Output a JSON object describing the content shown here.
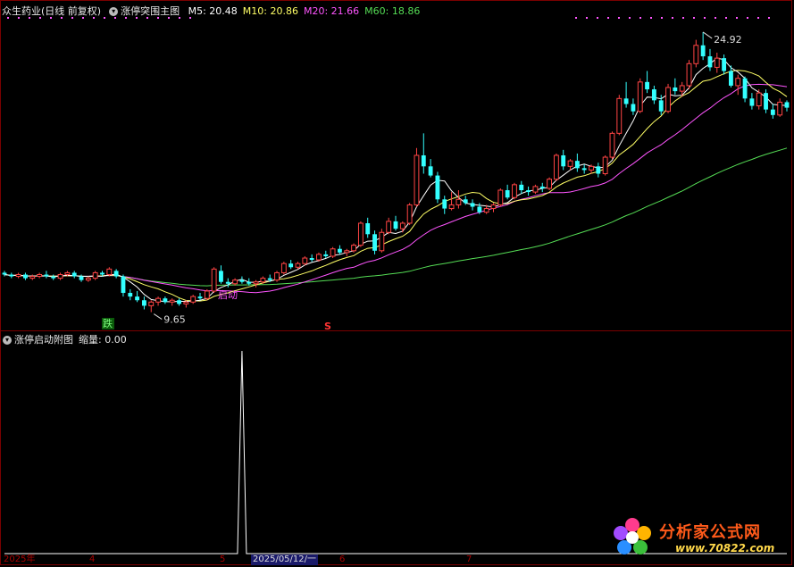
{
  "header": {
    "title": "众生药业(日线 前复权)",
    "indicator": "涨停突围主图",
    "ma": [
      {
        "label": "M5: 20.48",
        "color": "#ffffff"
      },
      {
        "label": "M10: 20.86",
        "color": "#ffff66"
      },
      {
        "label": "M20: 21.66",
        "color": "#ff55ff"
      },
      {
        "label": "M60: 18.86",
        "color": "#55dd55"
      }
    ]
  },
  "sub_header": {
    "title": "涨停启动附图",
    "value_label": "缩量: 0.00"
  },
  "annotations": {
    "high": "24.92",
    "low": "9.65",
    "qidong": "启动",
    "die": "跌",
    "s": "S"
  },
  "date_axis": [
    "2025年",
    "4",
    "5",
    "2025/05/12/一",
    "6",
    "7"
  ],
  "watermark": {
    "name": "分析家公式网",
    "url": "www.70822.com"
  },
  "colors": {
    "up": "#ff4444",
    "down": "#33ffff",
    "ma5": "#ffffff",
    "ma10": "#ffff66",
    "ma20": "#ff55ff",
    "ma60": "#55dd55",
    "spike": "#ffffff",
    "dots": "#ff55ff"
  },
  "chart_data": [
    {
      "type": "candlestick",
      "title": "众生药业(日线 前复权)",
      "ylim": [
        8.9,
        25.6
      ],
      "ohlc": [
        [
          11.8,
          11.9,
          11.6,
          11.7
        ],
        [
          11.7,
          11.8,
          11.5,
          11.6
        ],
        [
          11.6,
          11.8,
          11.5,
          11.7
        ],
        [
          11.7,
          11.8,
          11.4,
          11.5
        ],
        [
          11.5,
          11.7,
          11.4,
          11.6
        ],
        [
          11.6,
          11.8,
          11.5,
          11.7
        ],
        [
          11.7,
          11.9,
          11.5,
          11.6
        ],
        [
          11.6,
          11.7,
          11.4,
          11.5
        ],
        [
          11.5,
          11.8,
          11.4,
          11.7
        ],
        [
          11.7,
          11.9,
          11.6,
          11.8
        ],
        [
          11.8,
          11.9,
          11.5,
          11.6
        ],
        [
          11.6,
          11.7,
          11.3,
          11.4
        ],
        [
          11.4,
          11.6,
          11.3,
          11.5
        ],
        [
          11.5,
          11.9,
          11.4,
          11.8
        ],
        [
          11.8,
          11.9,
          11.6,
          11.7
        ],
        [
          11.7,
          12.1,
          11.6,
          12.0
        ],
        [
          11.9,
          12.0,
          11.5,
          11.6
        ],
        [
          11.6,
          11.7,
          10.5,
          10.7
        ],
        [
          10.7,
          10.9,
          10.3,
          10.5
        ],
        [
          10.5,
          10.8,
          10.2,
          10.3
        ],
        [
          10.3,
          10.5,
          9.8,
          10.0
        ],
        [
          10.0,
          10.3,
          9.65,
          10.2
        ],
        [
          10.2,
          10.5,
          10.0,
          10.4
        ],
        [
          10.4,
          10.5,
          10.1,
          10.2
        ],
        [
          10.2,
          10.4,
          10.0,
          10.3
        ],
        [
          10.3,
          10.4,
          10.0,
          10.1
        ],
        [
          10.1,
          10.3,
          9.9,
          10.2
        ],
        [
          10.2,
          10.6,
          10.1,
          10.5
        ],
        [
          10.5,
          10.7,
          10.3,
          10.4
        ],
        [
          10.4,
          10.9,
          10.3,
          10.8
        ],
        [
          10.8,
          12.1,
          10.7,
          12.0
        ],
        [
          11.9,
          12.2,
          11.2,
          11.3
        ],
        [
          11.3,
          11.5,
          11.0,
          11.2
        ],
        [
          11.2,
          11.5,
          11.1,
          11.4
        ],
        [
          11.4,
          11.6,
          11.2,
          11.3
        ],
        [
          11.3,
          11.5,
          11.1,
          11.2
        ],
        [
          11.2,
          11.4,
          11.0,
          11.3
        ],
        [
          11.3,
          11.6,
          11.2,
          11.5
        ],
        [
          11.5,
          11.7,
          11.3,
          11.4
        ],
        [
          11.4,
          11.9,
          11.3,
          11.8
        ],
        [
          11.8,
          12.4,
          11.7,
          12.3
        ],
        [
          12.3,
          12.5,
          12.0,
          12.1
        ],
        [
          12.1,
          12.4,
          12.0,
          12.3
        ],
        [
          12.3,
          12.7,
          12.2,
          12.6
        ],
        [
          12.6,
          12.8,
          12.4,
          12.5
        ],
        [
          12.5,
          12.9,
          12.4,
          12.8
        ],
        [
          12.8,
          13.0,
          12.6,
          12.7
        ],
        [
          12.7,
          13.2,
          12.6,
          13.1
        ],
        [
          13.1,
          13.3,
          12.8,
          12.9
        ],
        [
          12.9,
          13.1,
          12.7,
          13.0
        ],
        [
          13.0,
          13.4,
          12.9,
          13.3
        ],
        [
          13.3,
          14.6,
          13.2,
          14.5
        ],
        [
          14.5,
          14.8,
          13.7,
          13.9
        ],
        [
          13.9,
          14.1,
          12.8,
          13.0
        ],
        [
          13.0,
          14.2,
          12.9,
          14.0
        ],
        [
          14.0,
          14.8,
          13.9,
          14.6
        ],
        [
          14.6,
          14.9,
          14.1,
          14.2
        ],
        [
          14.2,
          14.6,
          14.0,
          14.5
        ],
        [
          14.5,
          15.6,
          14.4,
          15.5
        ],
        [
          15.5,
          18.6,
          15.4,
          18.2
        ],
        [
          18.2,
          19.4,
          17.2,
          17.6
        ],
        [
          17.6,
          18.0,
          17.0,
          17.1
        ],
        [
          17.1,
          17.3,
          15.6,
          15.8
        ],
        [
          15.8,
          16.0,
          15.0,
          15.3
        ],
        [
          15.3,
          16.2,
          15.2,
          15.5
        ],
        [
          15.5,
          16.3,
          15.3,
          15.8
        ],
        [
          15.8,
          16.0,
          15.5,
          15.6
        ],
        [
          15.6,
          15.8,
          15.2,
          15.4
        ],
        [
          15.4,
          15.6,
          15.0,
          15.1
        ],
        [
          15.1,
          15.5,
          15.0,
          15.3
        ],
        [
          15.3,
          15.6,
          15.1,
          15.5
        ],
        [
          15.5,
          16.4,
          15.4,
          16.3
        ],
        [
          16.3,
          16.6,
          15.8,
          15.9
        ],
        [
          15.9,
          16.7,
          15.8,
          16.6
        ],
        [
          16.6,
          16.8,
          16.1,
          16.3
        ],
        [
          16.3,
          16.5,
          16.0,
          16.2
        ],
        [
          16.2,
          16.6,
          16.1,
          16.5
        ],
        [
          16.5,
          16.7,
          16.2,
          16.4
        ],
        [
          16.4,
          17.0,
          16.3,
          16.9
        ],
        [
          16.9,
          18.3,
          16.8,
          18.2
        ],
        [
          18.2,
          18.5,
          17.4,
          17.6
        ],
        [
          17.6,
          18.0,
          17.4,
          17.9
        ],
        [
          17.9,
          18.3,
          17.3,
          17.5
        ],
        [
          17.5,
          17.7,
          17.2,
          17.4
        ],
        [
          17.4,
          17.7,
          17.2,
          17.6
        ],
        [
          17.6,
          17.8,
          17.0,
          17.2
        ],
        [
          17.2,
          18.2,
          17.1,
          18.1
        ],
        [
          18.1,
          19.5,
          18.0,
          19.4
        ],
        [
          19.4,
          21.5,
          19.3,
          21.3
        ],
        [
          21.3,
          22.2,
          20.8,
          21.0
        ],
        [
          21.0,
          21.3,
          20.4,
          20.6
        ],
        [
          20.6,
          22.4,
          20.5,
          22.2
        ],
        [
          22.2,
          22.8,
          21.6,
          21.8
        ],
        [
          21.8,
          22.0,
          21.0,
          21.2
        ],
        [
          21.2,
          21.5,
          20.4,
          20.6
        ],
        [
          20.6,
          22.1,
          20.5,
          21.9
        ],
        [
          21.9,
          22.4,
          21.5,
          21.7
        ],
        [
          21.7,
          22.2,
          21.4,
          22.0
        ],
        [
          22.0,
          23.4,
          21.8,
          23.2
        ],
        [
          23.2,
          24.5,
          23.0,
          24.2
        ],
        [
          24.2,
          24.92,
          23.4,
          23.6
        ],
        [
          23.6,
          24.0,
          22.8,
          23.0
        ],
        [
          23.0,
          23.8,
          22.7,
          23.5
        ],
        [
          23.5,
          23.7,
          22.6,
          22.8
        ],
        [
          22.8,
          23.1,
          21.9,
          22.0
        ],
        [
          22.0,
          22.6,
          21.5,
          22.4
        ],
        [
          22.4,
          22.5,
          21.1,
          21.3
        ],
        [
          21.3,
          21.6,
          20.7,
          20.9
        ],
        [
          20.9,
          21.8,
          20.7,
          21.6
        ],
        [
          21.6,
          21.8,
          20.5,
          20.7
        ],
        [
          20.7,
          21.0,
          20.2,
          20.4
        ],
        [
          20.4,
          21.3,
          20.3,
          21.1
        ],
        [
          21.1,
          21.2,
          20.6,
          20.8
        ]
      ]
    },
    {
      "type": "line",
      "title": "涨停启动附图",
      "ylim": [
        0,
        1
      ],
      "spike_index": 34,
      "spike_value": 1
    }
  ]
}
